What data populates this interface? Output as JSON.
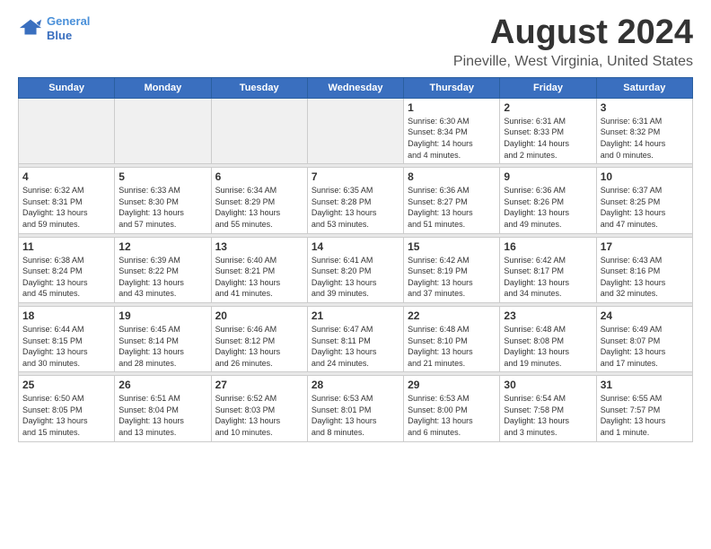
{
  "header": {
    "logo_line1": "General",
    "logo_line2": "Blue",
    "month_title": "August 2024",
    "location": "Pineville, West Virginia, United States"
  },
  "weekdays": [
    "Sunday",
    "Monday",
    "Tuesday",
    "Wednesday",
    "Thursday",
    "Friday",
    "Saturday"
  ],
  "weeks": [
    [
      {
        "day": "",
        "info": ""
      },
      {
        "day": "",
        "info": ""
      },
      {
        "day": "",
        "info": ""
      },
      {
        "day": "",
        "info": ""
      },
      {
        "day": "1",
        "info": "Sunrise: 6:30 AM\nSunset: 8:34 PM\nDaylight: 14 hours\nand 4 minutes."
      },
      {
        "day": "2",
        "info": "Sunrise: 6:31 AM\nSunset: 8:33 PM\nDaylight: 14 hours\nand 2 minutes."
      },
      {
        "day": "3",
        "info": "Sunrise: 6:31 AM\nSunset: 8:32 PM\nDaylight: 14 hours\nand 0 minutes."
      }
    ],
    [
      {
        "day": "4",
        "info": "Sunrise: 6:32 AM\nSunset: 8:31 PM\nDaylight: 13 hours\nand 59 minutes."
      },
      {
        "day": "5",
        "info": "Sunrise: 6:33 AM\nSunset: 8:30 PM\nDaylight: 13 hours\nand 57 minutes."
      },
      {
        "day": "6",
        "info": "Sunrise: 6:34 AM\nSunset: 8:29 PM\nDaylight: 13 hours\nand 55 minutes."
      },
      {
        "day": "7",
        "info": "Sunrise: 6:35 AM\nSunset: 8:28 PM\nDaylight: 13 hours\nand 53 minutes."
      },
      {
        "day": "8",
        "info": "Sunrise: 6:36 AM\nSunset: 8:27 PM\nDaylight: 13 hours\nand 51 minutes."
      },
      {
        "day": "9",
        "info": "Sunrise: 6:36 AM\nSunset: 8:26 PM\nDaylight: 13 hours\nand 49 minutes."
      },
      {
        "day": "10",
        "info": "Sunrise: 6:37 AM\nSunset: 8:25 PM\nDaylight: 13 hours\nand 47 minutes."
      }
    ],
    [
      {
        "day": "11",
        "info": "Sunrise: 6:38 AM\nSunset: 8:24 PM\nDaylight: 13 hours\nand 45 minutes."
      },
      {
        "day": "12",
        "info": "Sunrise: 6:39 AM\nSunset: 8:22 PM\nDaylight: 13 hours\nand 43 minutes."
      },
      {
        "day": "13",
        "info": "Sunrise: 6:40 AM\nSunset: 8:21 PM\nDaylight: 13 hours\nand 41 minutes."
      },
      {
        "day": "14",
        "info": "Sunrise: 6:41 AM\nSunset: 8:20 PM\nDaylight: 13 hours\nand 39 minutes."
      },
      {
        "day": "15",
        "info": "Sunrise: 6:42 AM\nSunset: 8:19 PM\nDaylight: 13 hours\nand 37 minutes."
      },
      {
        "day": "16",
        "info": "Sunrise: 6:42 AM\nSunset: 8:17 PM\nDaylight: 13 hours\nand 34 minutes."
      },
      {
        "day": "17",
        "info": "Sunrise: 6:43 AM\nSunset: 8:16 PM\nDaylight: 13 hours\nand 32 minutes."
      }
    ],
    [
      {
        "day": "18",
        "info": "Sunrise: 6:44 AM\nSunset: 8:15 PM\nDaylight: 13 hours\nand 30 minutes."
      },
      {
        "day": "19",
        "info": "Sunrise: 6:45 AM\nSunset: 8:14 PM\nDaylight: 13 hours\nand 28 minutes."
      },
      {
        "day": "20",
        "info": "Sunrise: 6:46 AM\nSunset: 8:12 PM\nDaylight: 13 hours\nand 26 minutes."
      },
      {
        "day": "21",
        "info": "Sunrise: 6:47 AM\nSunset: 8:11 PM\nDaylight: 13 hours\nand 24 minutes."
      },
      {
        "day": "22",
        "info": "Sunrise: 6:48 AM\nSunset: 8:10 PM\nDaylight: 13 hours\nand 21 minutes."
      },
      {
        "day": "23",
        "info": "Sunrise: 6:48 AM\nSunset: 8:08 PM\nDaylight: 13 hours\nand 19 minutes."
      },
      {
        "day": "24",
        "info": "Sunrise: 6:49 AM\nSunset: 8:07 PM\nDaylight: 13 hours\nand 17 minutes."
      }
    ],
    [
      {
        "day": "25",
        "info": "Sunrise: 6:50 AM\nSunset: 8:05 PM\nDaylight: 13 hours\nand 15 minutes."
      },
      {
        "day": "26",
        "info": "Sunrise: 6:51 AM\nSunset: 8:04 PM\nDaylight: 13 hours\nand 13 minutes."
      },
      {
        "day": "27",
        "info": "Sunrise: 6:52 AM\nSunset: 8:03 PM\nDaylight: 13 hours\nand 10 minutes."
      },
      {
        "day": "28",
        "info": "Sunrise: 6:53 AM\nSunset: 8:01 PM\nDaylight: 13 hours\nand 8 minutes."
      },
      {
        "day": "29",
        "info": "Sunrise: 6:53 AM\nSunset: 8:00 PM\nDaylight: 13 hours\nand 6 minutes."
      },
      {
        "day": "30",
        "info": "Sunrise: 6:54 AM\nSunset: 7:58 PM\nDaylight: 13 hours\nand 3 minutes."
      },
      {
        "day": "31",
        "info": "Sunrise: 6:55 AM\nSunset: 7:57 PM\nDaylight: 13 hours\nand 1 minute."
      }
    ]
  ]
}
